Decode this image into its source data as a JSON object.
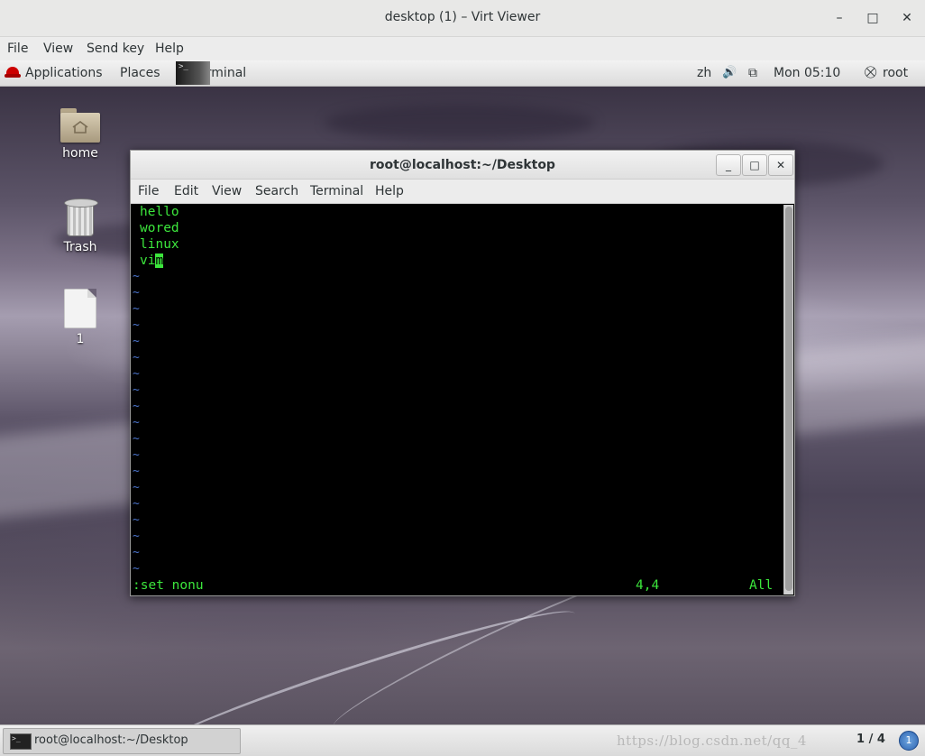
{
  "viewer": {
    "title": "desktop (1) – Virt Viewer",
    "minimize_glyph": "–",
    "maximize_glyph": "□",
    "close_glyph": "✕",
    "menu": [
      "File",
      "View",
      "Send key",
      "Help"
    ]
  },
  "panel": {
    "applications": "Applications",
    "places": "Places",
    "terminal": "Terminal",
    "terminal_icon_glyph": ">_",
    "input_method": "zh",
    "volume_glyph": "🔊",
    "network_glyph": "⧉",
    "clock": "Mon 05:10",
    "user": "root",
    "user_glyph": "⛒"
  },
  "desktop": {
    "icons": [
      {
        "label": "home"
      },
      {
        "label": "Trash"
      },
      {
        "label": "1"
      }
    ]
  },
  "terminal": {
    "title": "root@localhost:~/Desktop",
    "minimize_glyph": "_",
    "maximize_glyph": "□",
    "close_glyph": "✕",
    "menu": [
      "File",
      "Edit",
      "View",
      "Search",
      "Terminal",
      "Help"
    ],
    "lines": [
      "hello",
      "wored",
      "linux"
    ],
    "line4_before_cursor": "vi",
    "cursor_char": "m",
    "tilde": "~",
    "command": ":set nonu",
    "position": "4,4",
    "scroll": "All"
  },
  "taskbar": {
    "window_label": "root@localhost:~/Desktop",
    "watermark": "https://blog.csdn.net/qq_4",
    "workspace": "1 / 4",
    "notification_count": "1"
  }
}
